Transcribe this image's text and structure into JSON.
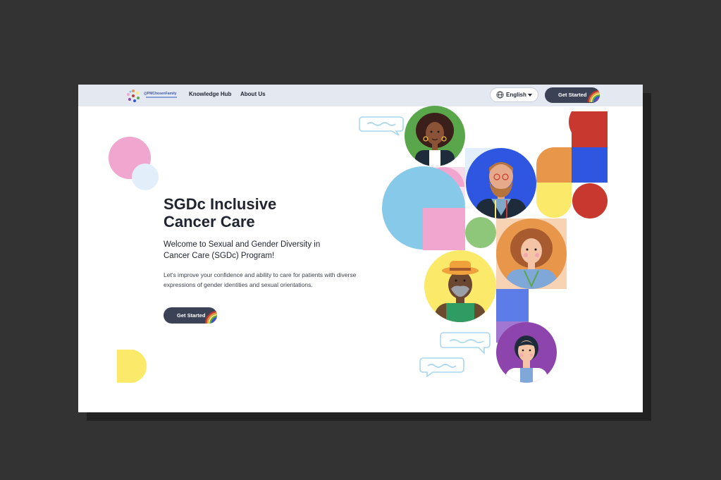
{
  "nav": {
    "logo_text": "@PMChosenFamily",
    "links": [
      {
        "label": "Knowledge Hub"
      },
      {
        "label": "About Us"
      }
    ],
    "language": {
      "selected": "English",
      "icon": "globe-icon"
    },
    "cta_label": "Get Started"
  },
  "hero": {
    "title_line1": "SGDc Inclusive",
    "title_line2": "Cancer Care",
    "subtitle": "Welcome to Sexual and Gender Diversity in Cancer Care (SGDc) Program!",
    "description": "Let's improve your confidence and ability to care for patients with diverse expressions of gender identities and sexual orientations.",
    "cta_label": "Get Started"
  },
  "colors": {
    "nav_bg": "#e3e8f1",
    "button_bg": "#3b4256",
    "pink": "#f0a6cf",
    "light_blue": "#e2eefa",
    "sky": "#87c9e8",
    "yellow": "#fbe96a",
    "blue": "#2f56e0",
    "red": "#c8382f",
    "orange": "#e8974a",
    "green": "#5aa64a"
  }
}
